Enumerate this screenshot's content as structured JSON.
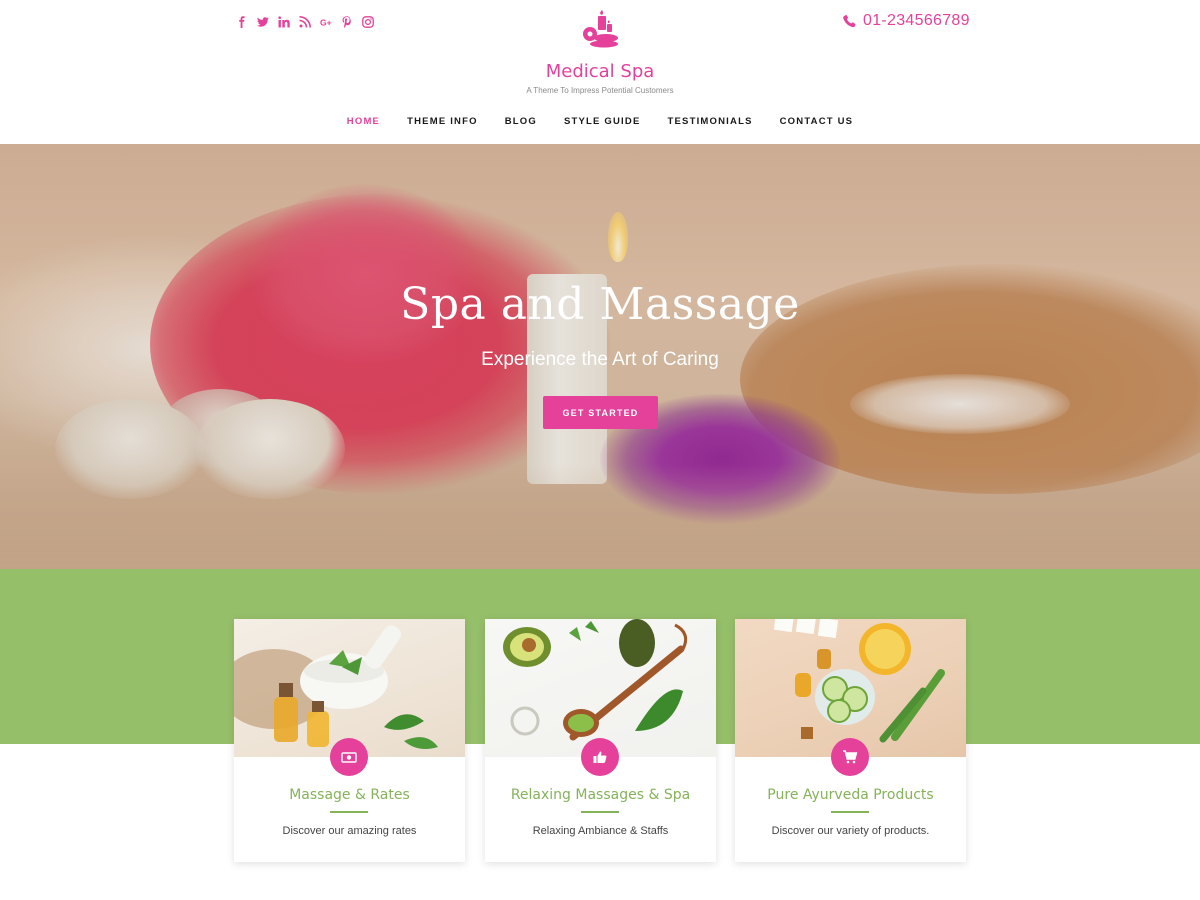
{
  "header": {
    "social_icons": [
      "facebook-icon",
      "twitter-icon",
      "linkedin-icon",
      "rss-icon",
      "google-plus-icon",
      "pinterest-icon",
      "instagram-icon"
    ],
    "phone_icon": "phone-icon",
    "phone": "01-234566789",
    "logo_icon": "spa-candle-logo-icon",
    "site_title": "Medical Spa",
    "site_description": "A Theme To Impress Potential Customers"
  },
  "nav": {
    "items": [
      {
        "label": "HOME",
        "active": true
      },
      {
        "label": "THEME INFO",
        "active": false
      },
      {
        "label": "BLOG",
        "active": false
      },
      {
        "label": "STYLE GUIDE",
        "active": false
      },
      {
        "label": "TESTIMONIALS",
        "active": false
      },
      {
        "label": "CONTACT US",
        "active": false
      }
    ]
  },
  "hero": {
    "title": "Spa and Massage",
    "subtitle": "Experience the Art of Caring",
    "button": "GET STARTED"
  },
  "features": [
    {
      "icon": "money-icon",
      "title": "Massage & Rates",
      "text": "Discover our amazing rates"
    },
    {
      "icon": "thumbs-up-icon",
      "title": "Relaxing Massages & Spa",
      "text": "Relaxing Ambiance & Staffs"
    },
    {
      "icon": "shopping-cart-icon",
      "title": "Pure Ayurveda Products",
      "text": "Discover our variety of products."
    }
  ],
  "colors": {
    "accent": "#e5409a",
    "green": "#96bf6a",
    "heading_green": "#85b35a"
  }
}
